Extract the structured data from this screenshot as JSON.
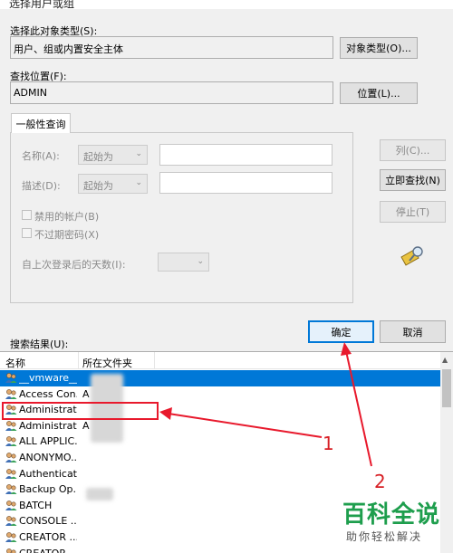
{
  "dialog": {
    "title": "选择用户或组"
  },
  "object_type": {
    "label": "选择此对象类型(S):",
    "value": "用户、组或内置安全主体",
    "button": "对象类型(O)..."
  },
  "location": {
    "label": "查找位置(F):",
    "value": "ADMIN",
    "button": "位置(L)..."
  },
  "query": {
    "tab": "一般性查询",
    "name_label": "名称(A):",
    "desc_label": "描述(D):",
    "combo_value": "起始为",
    "disabled_accounts": "禁用的帐户(B)",
    "non_expiring": "不过期密码(X)",
    "days_label": "自上次登录后的天数(I):"
  },
  "side_buttons": {
    "columns": "列(C)...",
    "find_now": "立即查找(N)",
    "stop": "停止(T)"
  },
  "footer": {
    "ok": "确定",
    "cancel": "取消"
  },
  "results": {
    "label": "搜索结果(U):",
    "columns": [
      "名称",
      "所在文件夹"
    ],
    "rows": [
      {
        "name": "__vmware__",
        "folder": "",
        "selected": true
      },
      {
        "name": "Access Con...",
        "folder": "A",
        "selected": false
      },
      {
        "name": "Administrat...",
        "folder": "",
        "selected": false
      },
      {
        "name": "Administrat...",
        "folder": "A",
        "selected": false
      },
      {
        "name": "ALL APPLIC...",
        "folder": "",
        "selected": false
      },
      {
        "name": "ANONYMO...",
        "folder": "",
        "selected": false
      },
      {
        "name": "Authenticat...",
        "folder": "",
        "selected": false
      },
      {
        "name": "Backup Op...",
        "folder": "",
        "selected": false
      },
      {
        "name": "BATCH",
        "folder": "",
        "selected": false
      },
      {
        "name": "CONSOLE ...",
        "folder": "",
        "selected": false
      },
      {
        "name": "CREATOR ...",
        "folder": "",
        "selected": false
      },
      {
        "name": "CREATOR ...",
        "folder": "",
        "selected": false
      }
    ]
  },
  "annotations": {
    "n1": "1",
    "n2": "2",
    "color": "#d71f25"
  },
  "watermark": {
    "title": "百科全说",
    "subtitle": "助你轻松解决"
  }
}
